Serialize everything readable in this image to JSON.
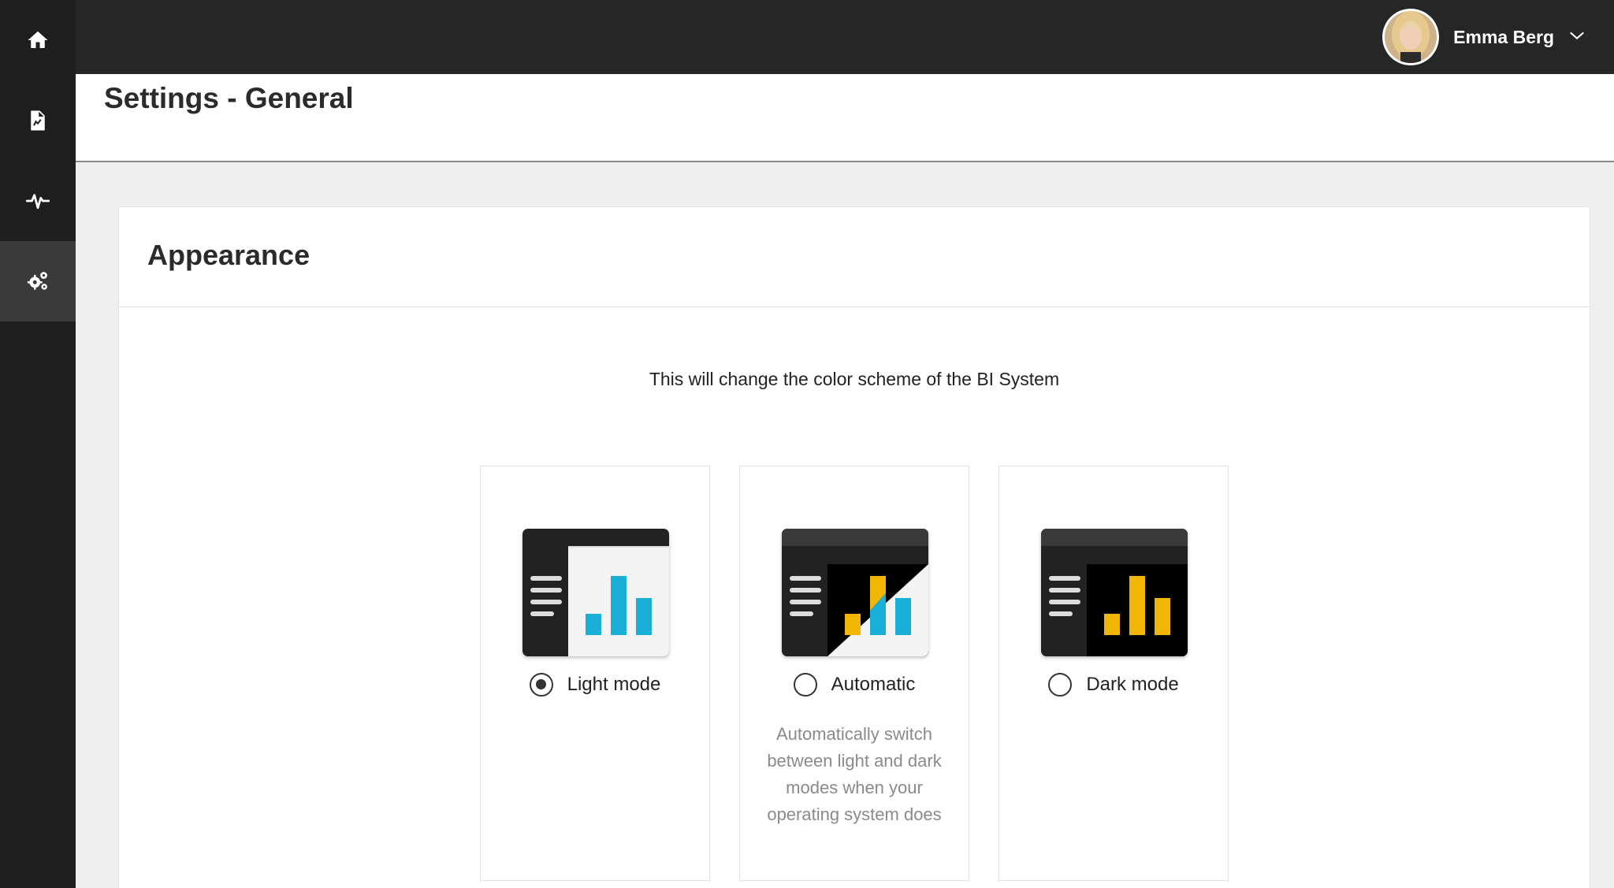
{
  "nav": {
    "items": [
      {
        "icon": "home-icon",
        "active": false
      },
      {
        "icon": "report-icon",
        "active": false
      },
      {
        "icon": "activity-icon",
        "active": false
      },
      {
        "icon": "settings-gears-icon",
        "active": true
      }
    ]
  },
  "user": {
    "name": "Emma Berg"
  },
  "page": {
    "title_bold": "Settings",
    "title_rest": " - General"
  },
  "appearance": {
    "title": "Appearance",
    "description": "This will change the color scheme of the BI System",
    "options": [
      {
        "label": "Light mode",
        "selected": true,
        "description": ""
      },
      {
        "label": "Automatic",
        "selected": false,
        "description": "Automatically switch between light and dark modes when your operating system does"
      },
      {
        "label": "Dark mode",
        "selected": false,
        "description": ""
      }
    ]
  },
  "colors": {
    "rail": "#1e1e1e",
    "topbar": "#262626",
    "light_bars": "#1aafd6",
    "dark_bars": "#f2b705"
  }
}
